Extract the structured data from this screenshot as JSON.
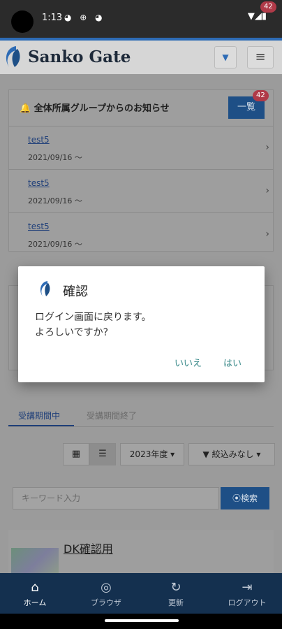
{
  "status_bar": {
    "time": "1:13",
    "icons": "◕ ⊕ ◕",
    "right": "▼◢▮"
  },
  "header": {
    "brand": "Sanko Gate",
    "dropdown_icon": "▼",
    "menu_icon": "≡",
    "menu_badge": "42"
  },
  "notices": {
    "title": "全体所属グループからのお知らせ",
    "list_button": "一覧",
    "list_badge": "42",
    "items": [
      {
        "title": "test5",
        "date": "2021/09/16 ～"
      },
      {
        "title": "test5",
        "date": "2021/09/16 ～"
      },
      {
        "title": "test5",
        "date": "2021/09/16 ～"
      }
    ]
  },
  "tabs": {
    "active": "受講期間中",
    "inactive": "受講期間終了"
  },
  "filters": {
    "year": "2023年度 ▾",
    "filter": "▼ 絞込みなし ▾",
    "grid_icon": "▦",
    "list_icon": "☰"
  },
  "search": {
    "placeholder": "キーワード入力",
    "button": "⦿検索"
  },
  "course": {
    "title": "DK確認用"
  },
  "bottom_nav": [
    {
      "label": "ホーム",
      "icon": "⌂"
    },
    {
      "label": "ブラウザ",
      "icon": "◎"
    },
    {
      "label": "更新",
      "icon": "↻"
    },
    {
      "label": "ログアウト",
      "icon": "⇥"
    }
  ],
  "dialog": {
    "title": "確認",
    "message_line1": "ログイン画面に戻ります。",
    "message_line2": "よろしいですか?",
    "no": "いいえ",
    "yes": "はい"
  },
  "colors": {
    "accent": "#1e4f86",
    "nav": "#14304f",
    "dialog_button": "#3a8a8a",
    "badge": "#b03a48"
  }
}
